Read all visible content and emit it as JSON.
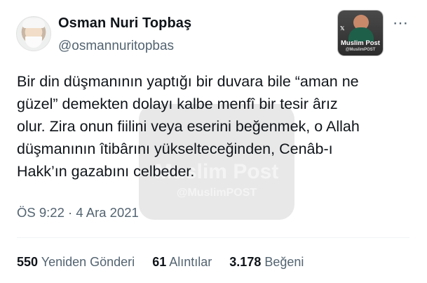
{
  "author": {
    "name": "Osman Nuri Topbaş",
    "handle": "@osmannuritopbas"
  },
  "logo": {
    "brand": "Muslim Post",
    "handle": "@MuslimPOST"
  },
  "watermark": {
    "brand": "Muslim Post",
    "handle": "@MuslimPOST"
  },
  "more_icon": "⋯",
  "tweet": {
    "text": "Bir din düşmanının yaptığı bir duvara bile “aman ne\ngüzel” demekten dolayı kalbe menfî bir tesir ârız\nolur. Zira onun fiilini veya eserini beğenmek, o Allah\ndüşmanının îtibârını yükselteceğinden, Cenâb-ı\nHakk’ın gazabını celbeder.",
    "time": "ÖS 9:22",
    "separator": "·",
    "date": "4 Ara 2021"
  },
  "stats": {
    "retweets_count": "550",
    "retweets_label": "Yeniden Gönderi",
    "quotes_count": "61",
    "quotes_label": "Alıntılar",
    "likes_count": "3.178",
    "likes_label": "Beğeni"
  }
}
